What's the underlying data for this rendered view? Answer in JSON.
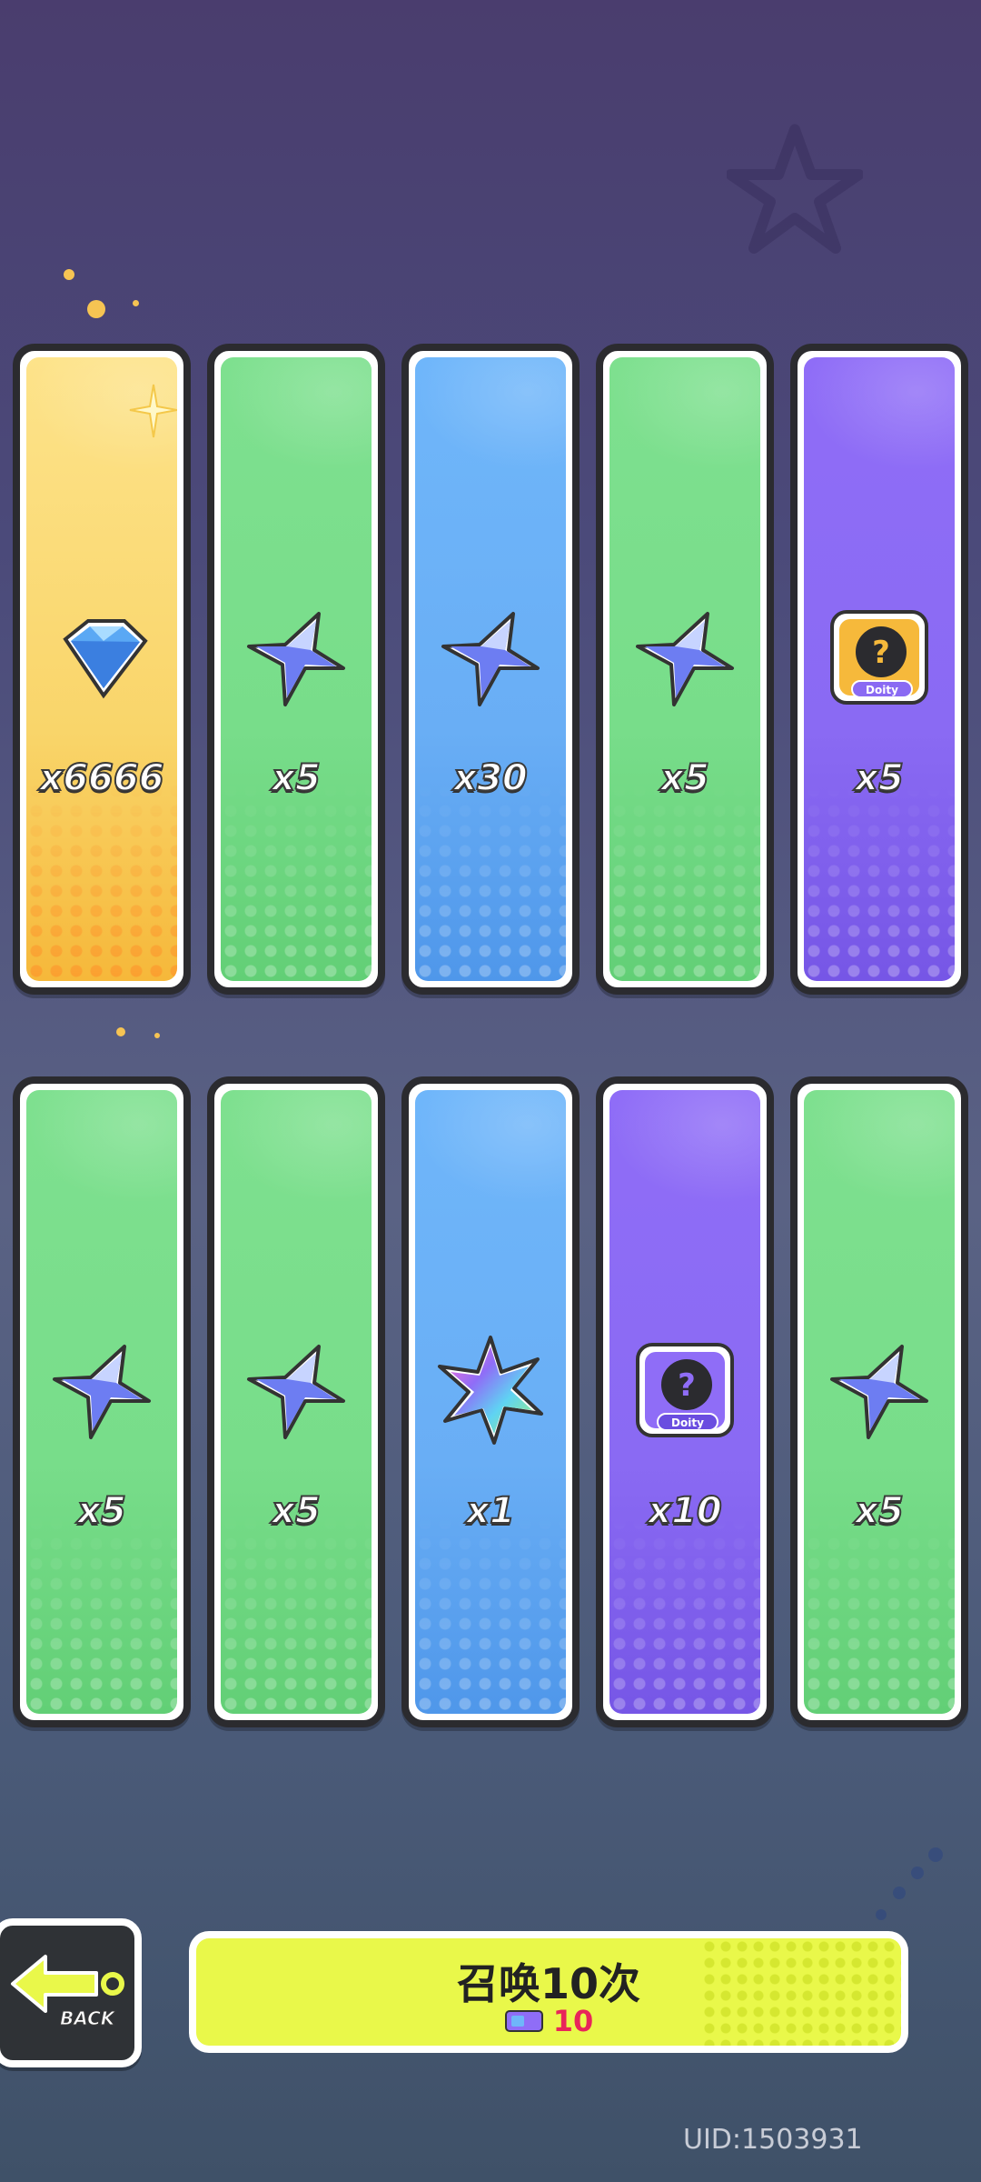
{
  "cards_row1": [
    {
      "rarity": "gold",
      "icon": "diamond-icon",
      "quantity": "x6666"
    },
    {
      "rarity": "green",
      "icon": "star-shard-icon",
      "quantity": "x5"
    },
    {
      "rarity": "blue",
      "icon": "star-shard-icon",
      "quantity": "x30"
    },
    {
      "rarity": "green",
      "icon": "star-shard-icon",
      "quantity": "x5"
    },
    {
      "rarity": "purple",
      "icon": "mystery-card-icon",
      "quantity": "x5"
    }
  ],
  "cards_row2": [
    {
      "rarity": "green",
      "icon": "star-shard-icon",
      "quantity": "x5"
    },
    {
      "rarity": "green",
      "icon": "star-shard-icon",
      "quantity": "x5"
    },
    {
      "rarity": "blue",
      "icon": "rainbow-leaf-icon",
      "quantity": "x1"
    },
    {
      "rarity": "purple",
      "icon": "mystery-card-icon",
      "quantity": "x10"
    },
    {
      "rarity": "green",
      "icon": "star-shard-icon",
      "quantity": "x5"
    }
  ],
  "mystery_badge_text": "Doity",
  "back_button": {
    "label": "BACK"
  },
  "summon_button": {
    "label": "召唤10次",
    "cost": "10",
    "cost_icon": "ticket-icon"
  },
  "uid": "UID:1503931",
  "colors": {
    "gold": "#f9d56a",
    "green": "#78dd8a",
    "blue": "#69aef5",
    "purple": "#8a6af3",
    "summon": "#e9f84a",
    "cost": "#e8255a"
  }
}
